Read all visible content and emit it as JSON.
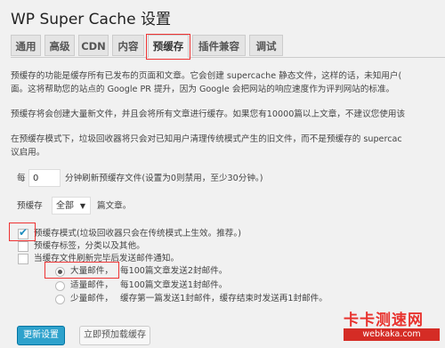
{
  "page_title": "WP Super Cache 设置",
  "tabs": [
    "通用",
    "高级",
    "CDN",
    "内容",
    "预缓存",
    "插件兼容",
    "调试"
  ],
  "active_tab": "预缓存",
  "paragraphs": {
    "intro_line1": "预缓存的功能是缓存所有已发布的页面和文章。它会创建 supercache 静态文件，这样的话，未知用户(",
    "intro_line2": "面。这将帮助您的站点的 Google PR 提升，因为 Google 会把网站的响应速度作为评判网站的标准。",
    "warning": "预缓存将会创建大量新文件，并且会将所有文章进行缓存。如果您有10000篇以上文章，不建议您使用该",
    "legacy_line1": "在预缓存模式下，垃圾回收器将只会对已知用户清理传统模式产生的旧文件，而不是预缓存的 supercac",
    "legacy_line2": "议启用。"
  },
  "refresh": {
    "prefix": "每",
    "value": "0",
    "suffix": "分钟刷新预缓存文件(设置为0则禁用，至少30分钟。)"
  },
  "precache_select": {
    "label": "预缓存",
    "value": "全部",
    "suffix": "篇文章。"
  },
  "options": {
    "mode": "预缓存模式(垃圾回收器只会在传统模式上生效。推荐。)",
    "tags": "预缓存标签，分类以及其他。",
    "email": "当缓存文件刷新完毕后发送邮件通知。"
  },
  "email_levels": [
    {
      "label": "大量邮件，",
      "desc": "每100篇文章发送2封邮件。",
      "selected": true
    },
    {
      "label": "适量邮件，",
      "desc": "每100篇文章发送1封邮件。",
      "selected": false
    },
    {
      "label": "少量邮件，",
      "desc": "缓存第一篇发送1封邮件，缓存结束时发送再1封邮件。",
      "selected": false
    }
  ],
  "buttons": {
    "update": "更新设置",
    "preload_now": "立即预加载缓存"
  },
  "watermark": {
    "main": "卡卡测速网",
    "sub": "webkaka.com"
  },
  "colors": {
    "accent": "#2ea2cc",
    "highlight": "#e33333",
    "watermark": "#e8322d"
  }
}
